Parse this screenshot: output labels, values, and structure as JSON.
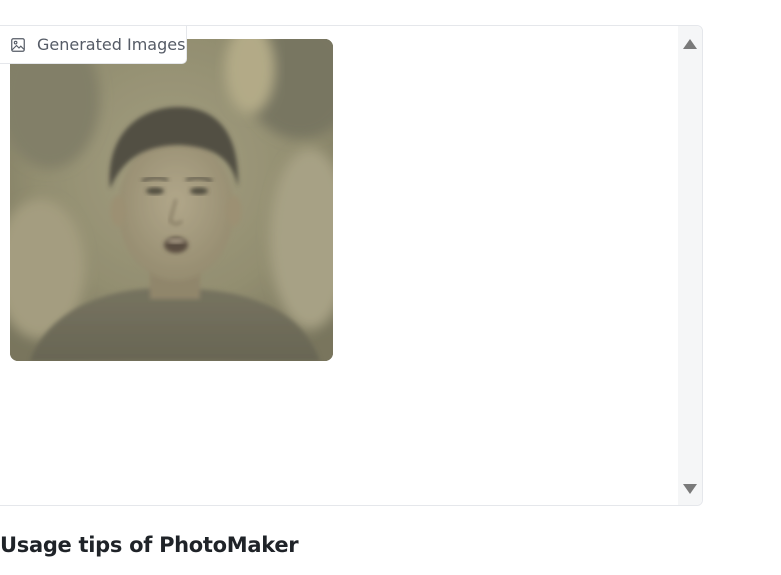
{
  "gallery": {
    "label": "Generated Images",
    "label_icon": "image-icon",
    "images": [
      {
        "alt": "generated portrait",
        "selected": false
      }
    ],
    "colors": {
      "border": "#e5e7eb",
      "label_text": "#555b66",
      "scrollbar_track": "#f5f6f7",
      "scrollbar_arrow": "#7a7a7a"
    }
  },
  "scrollbar": {
    "up_icon": "triangle-up-icon",
    "down_icon": "triangle-down-icon"
  },
  "tips": {
    "heading": "Usage tips of PhotoMaker"
  }
}
